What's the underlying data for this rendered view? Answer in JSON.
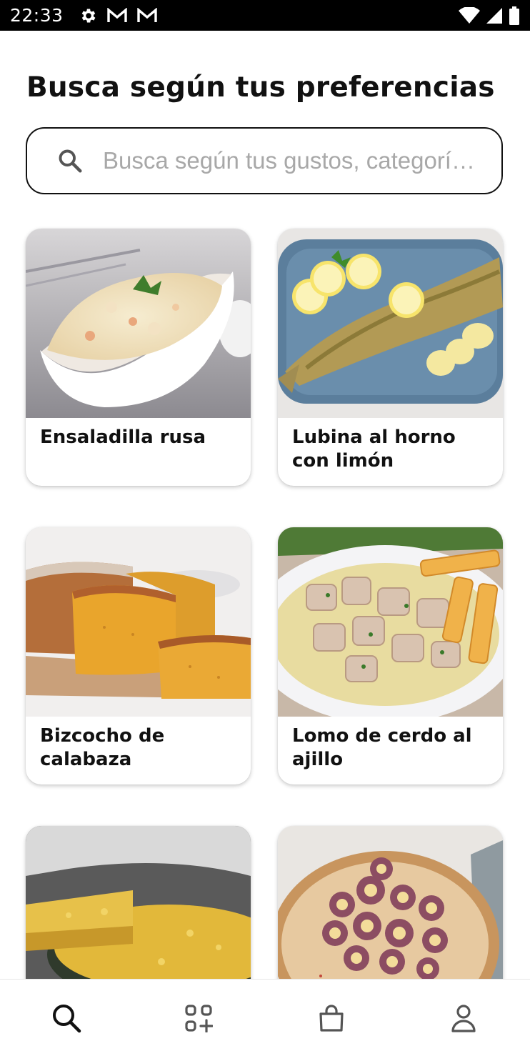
{
  "status_bar": {
    "time": "22:33",
    "left_icons": [
      "gear-icon",
      "gmail-icon",
      "gmail-icon"
    ],
    "right_icons": [
      "wifi-icon",
      "signal-icon",
      "battery-icon"
    ]
  },
  "page": {
    "title": "Busca según tus preferencias"
  },
  "search": {
    "placeholder": "Busca según tus gustos, categorí…",
    "value": ""
  },
  "recipes": [
    {
      "title": "Ensaladilla rusa",
      "image": "potato-salad-photo"
    },
    {
      "title": "Lubina al horno con limón",
      "image": "baked-sea-bass-photo"
    },
    {
      "title": "Bizcocho de calabaza",
      "image": "pumpkin-cake-photo"
    },
    {
      "title": "Lomo de cerdo al ajillo",
      "image": "garlic-pork-photo"
    },
    {
      "title": "",
      "image": "potato-omelette-photo"
    },
    {
      "title": "",
      "image": "galician-octopus-photo"
    }
  ],
  "bottom_nav": {
    "items": [
      {
        "icon": "search-icon",
        "active": true
      },
      {
        "icon": "categories-icon",
        "active": false
      },
      {
        "icon": "shopping-bag-icon",
        "active": false
      },
      {
        "icon": "profile-icon",
        "active": false
      }
    ]
  },
  "colors": {
    "text": "#111111",
    "placeholder": "#a8a8a8",
    "status_bar": "#000000",
    "nav_inactive": "#555555"
  }
}
